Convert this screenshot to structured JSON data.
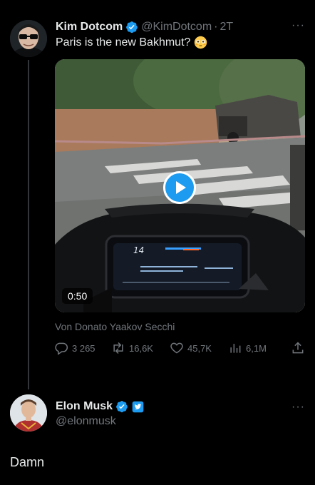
{
  "tweet": {
    "author_name": "Kim Dotcom",
    "author_handle": "@KimDotcom",
    "separator": "·",
    "time": "2T",
    "more": "···",
    "text": "Paris is the new Bakhmut?",
    "emoji": "flushed-face",
    "video_duration": "0:50",
    "attribution": "Von Donato Yaakov Secchi",
    "actions": {
      "replies": "3 265",
      "reposts": "16,6K",
      "likes": "45,7K",
      "views": "6,1M"
    }
  },
  "reply": {
    "author_name": "Elon Musk",
    "author_handle": "@elonmusk",
    "more": "···",
    "text": "Damn"
  },
  "colors": {
    "background": "#000000",
    "text": "#e7e9ea",
    "muted": "#71767b",
    "accent": "#1d9bf0",
    "gold": "#e8b339"
  }
}
